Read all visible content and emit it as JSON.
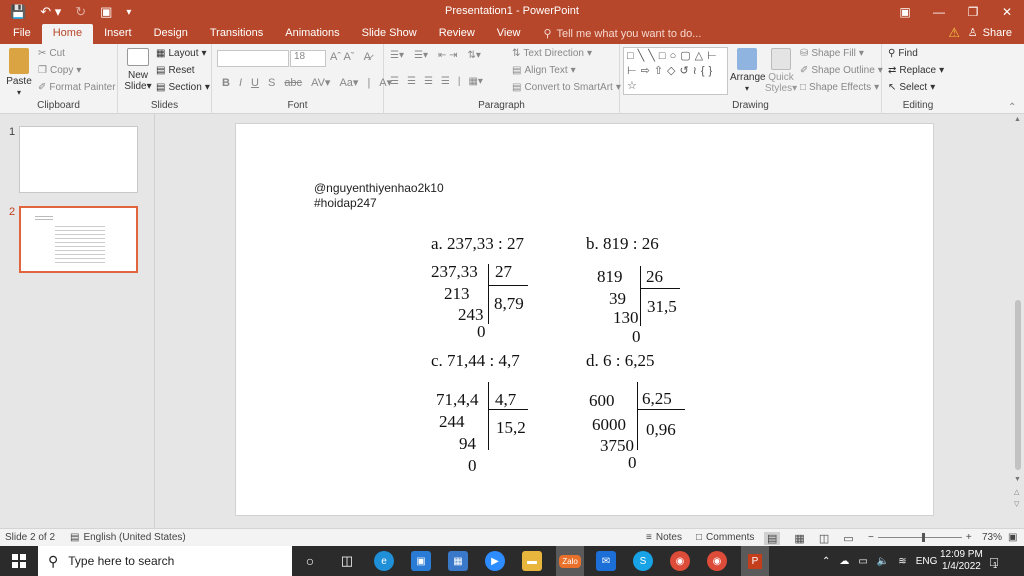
{
  "window": {
    "title": "Presentation1 - PowerPoint",
    "share_label": "Share",
    "tell_me": "Tell me what you want to do..."
  },
  "tabs": [
    "File",
    "Home",
    "Insert",
    "Design",
    "Transitions",
    "Animations",
    "Slide Show",
    "Review",
    "View"
  ],
  "ribbon": {
    "clipboard": {
      "label": "Clipboard",
      "paste": "Paste",
      "cut": "Cut",
      "copy": "Copy",
      "format_painter": "Format Painter"
    },
    "slides": {
      "label": "Slides",
      "new_slide": "New",
      "new_slide_2": "Slide",
      "layout": "Layout",
      "reset": "Reset",
      "section": "Section"
    },
    "font": {
      "label": "Font",
      "font_size": "18"
    },
    "paragraph": {
      "label": "Paragraph",
      "text_direction": "Text Direction",
      "align_text": "Align Text",
      "smartart": "Convert to SmartArt"
    },
    "drawing": {
      "label": "Drawing",
      "arrange": "Arrange",
      "quick_styles": "Quick",
      "quick_styles_2": "Styles",
      "shape_fill": "Shape Fill",
      "shape_outline": "Shape Outline",
      "shape_effects": "Shape Effects"
    },
    "editing": {
      "label": "Editing",
      "find": "Find",
      "replace": "Replace",
      "select": "Select"
    }
  },
  "thumbnails": [
    {
      "number": "1"
    },
    {
      "number": "2"
    }
  ],
  "slide": {
    "handle": "@nguyenthiyenhao2k10",
    "tag": "#hoidap247",
    "problems": {
      "a": {
        "title": "a. 237,33 : 27",
        "dividend": "237,33",
        "divisor": "27",
        "quotient": "8,79",
        "r1": "213",
        "r2": "243",
        "r3": "0"
      },
      "b": {
        "title": "b. 819 : 26",
        "dividend": "819",
        "divisor": "26",
        "quotient": "31,5",
        "r1": "39",
        "r2": "130",
        "r3": "0"
      },
      "c": {
        "title": "c. 71,44 : 4,7",
        "dividend": "71,4,4",
        "divisor": "4,7",
        "quotient": "15,2",
        "r1": "244",
        "r2": "94",
        "r3": "0"
      },
      "d": {
        "title": "d. 6 : 6,25",
        "dividend": "600",
        "divisor": "6,25",
        "quotient": "0,96",
        "r1": "6000",
        "r2": "3750",
        "r3": "0"
      }
    }
  },
  "status": {
    "slide_of": "Slide 2 of 2",
    "language": "English (United States)",
    "notes": "Notes",
    "comments": "Comments",
    "zoom": "73%"
  },
  "taskbar": {
    "search_placeholder": "Type here to search",
    "lang": "ENG",
    "time": "12:09 PM",
    "date": "1/4/2022",
    "notif_count": "1",
    "zalo": "Zalo"
  }
}
